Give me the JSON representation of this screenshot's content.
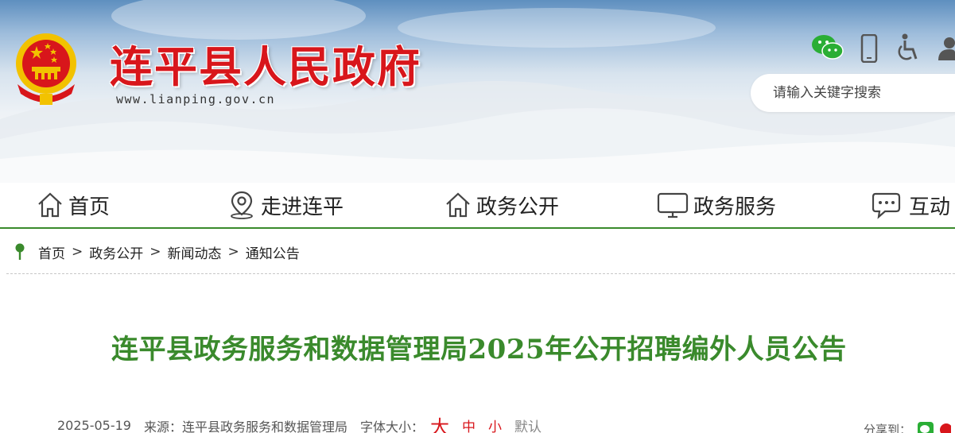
{
  "header": {
    "site_title": "连平县人民政府",
    "site_url": "www.lianping.gov.cn",
    "search_placeholder": "请输入关键字搜索",
    "icons": [
      "wechat-icon",
      "mobile-icon",
      "accessibility-icon",
      "user-icon"
    ]
  },
  "nav": {
    "items": [
      {
        "label": "首页",
        "icon": "home-icon"
      },
      {
        "label": "走进连平",
        "icon": "location-pin-icon"
      },
      {
        "label": "政务公开",
        "icon": "home-icon"
      },
      {
        "label": "政务服务",
        "icon": "monitor-icon"
      },
      {
        "label": "互动",
        "icon": "chat-icon"
      }
    ]
  },
  "breadcrumb": {
    "items": [
      "首页",
      "政务公开",
      "新闻动态",
      "通知公告"
    ],
    "separator": ">"
  },
  "article": {
    "title": "连平县政务服务和数据管理局2025年公开招聘编外人员公告",
    "date": "2025-05-19",
    "source_label": "来源：",
    "source": "连平县政务服务和数据管理局",
    "font_size_label": "字体大小：",
    "font_sizes": {
      "large": "大",
      "medium": "中",
      "small": "小",
      "default": "默认"
    },
    "share_label": "分享到："
  },
  "colors": {
    "brand_red": "#d8161b",
    "nav_green": "#3a8a2c",
    "title_green": "#3a8a2c"
  }
}
